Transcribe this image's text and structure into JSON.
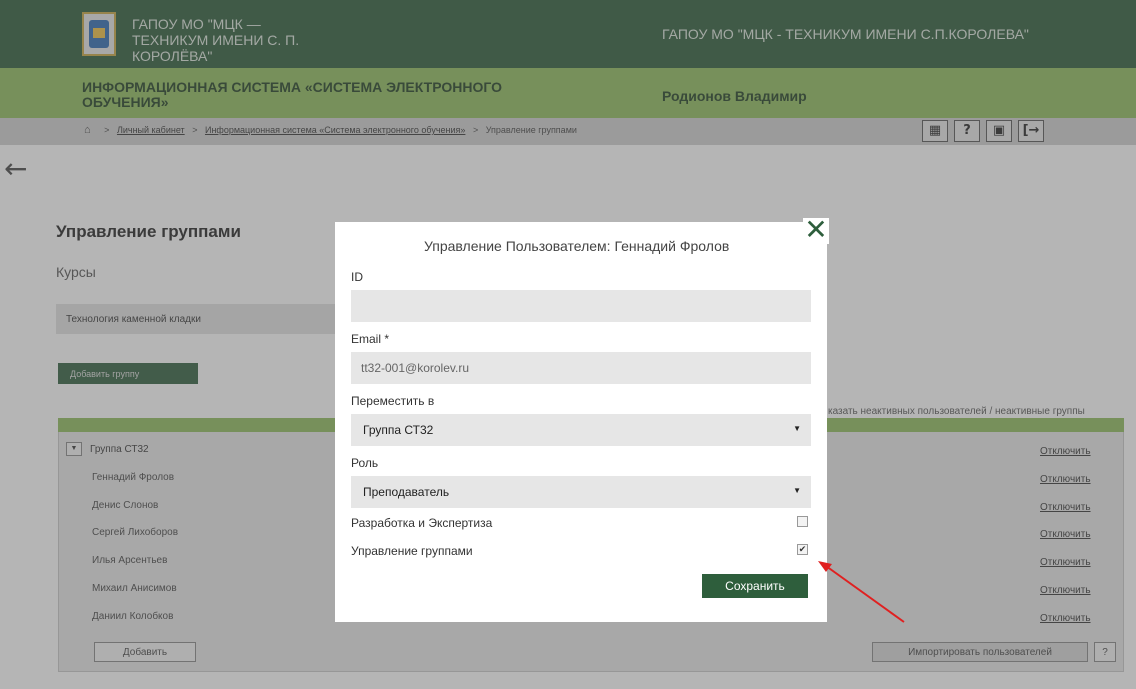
{
  "header": {
    "org_name_left": "ГАПОУ МО \"МЦК — ТЕХНИКУМ ИМЕНИ С. П. КОРОЛЁВА\"",
    "org_name_right": "ГАПОУ МО \"МЦК - ТЕХНИКУМ ИМЕНИ С.П.КОРОЛЕВА\"",
    "system_title": "ИНФОРМАЦИОННАЯ СИСТЕМА «СИСТЕМА ЭЛЕКТРОННОГО ОБУЧЕНИЯ»",
    "user_name": "Родионов Владимир"
  },
  "breadcrumb": {
    "home_icon": "home-icon",
    "sep": ">",
    "items": [
      "Личный кабинет",
      "Информационная система «Система электронного обучения»",
      "Управление группами"
    ]
  },
  "toolbar": {
    "icons": [
      "calendar-icon",
      "help-icon",
      "profile-icon",
      "logout-icon"
    ],
    "help_glyph": "?",
    "calendar_glyph": "▦",
    "profile_glyph": "▣",
    "logout_glyph": "[→"
  },
  "nav": {
    "back_glyph": "←"
  },
  "main": {
    "title": "Управление группами",
    "courses_label": "Курсы",
    "course_name": "Технология каменной кладки",
    "add_group_label": "Добавить группу",
    "show_inactive": "казать неактивных пользователей / неактивные группы",
    "group": {
      "name": "Группа СТ32",
      "expand_glyph": "▼",
      "members": [
        "Геннадий Фролов",
        "Денис Слонов",
        "Сергей Лихоборов",
        "Илья Арсентьев",
        "Михаил Анисимов",
        "Даниил Колобков"
      ]
    },
    "disable_label": "Отключить",
    "add_label": "Добавить",
    "import_label": "Импортировать пользователей",
    "help_label": "?"
  },
  "modal": {
    "title": "Управление Пользователем: Геннадий Фролов",
    "close_glyph": "✕",
    "id_label": "ID",
    "id_value": "",
    "email_label": "Email *",
    "email_value": "tt32-001@korolev.ru",
    "move_label": "Переместить в",
    "move_value": "Группа СТ32",
    "role_label": "Роль",
    "role_value": "Преподаватель",
    "select_arrow": "▼",
    "perm_dev_label": "Разработка и Экспертиза",
    "perm_dev_checked": false,
    "perm_groups_label": "Управление группами",
    "perm_groups_checked": true,
    "check_glyph": "✔",
    "save_label": "Сохранить"
  },
  "annotation": {
    "arrow_color": "#e02020"
  }
}
